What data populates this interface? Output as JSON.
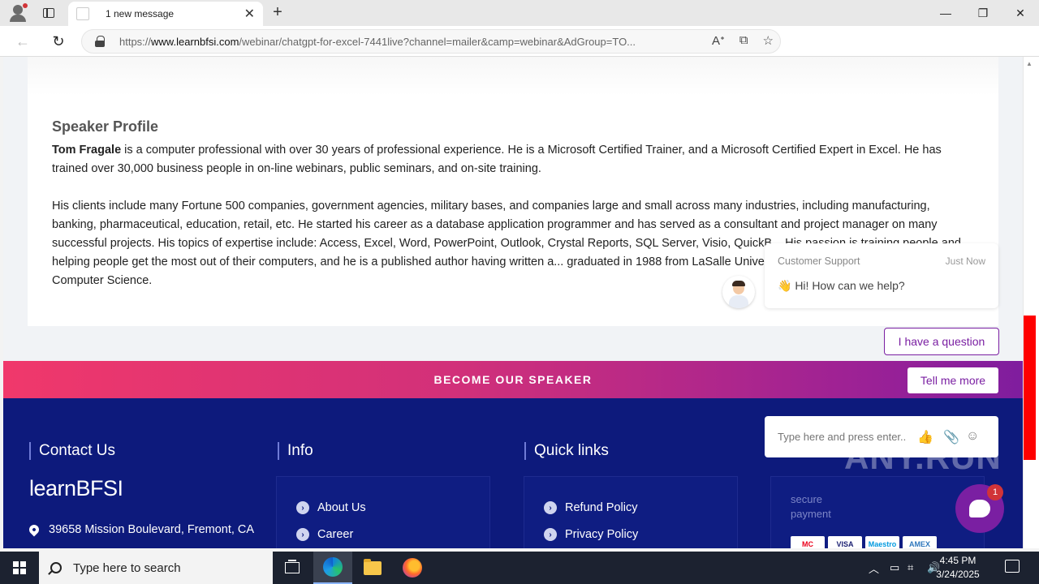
{
  "browser": {
    "tab_title": "1 new message",
    "url_prefix": "https://",
    "url_host": "www.learnbfsi.com",
    "url_rest": "/webinar/chatgpt-for-excel-7441live?channel=mailer&camp=webinar&AdGroup=TO..."
  },
  "speaker": {
    "heading": "Speaker Profile",
    "name": "Tom Fragale",
    "para1_rest": " is a computer professional with over 30 years of professional experience. He is a Microsoft Certified Trainer, and a Microsoft Certified Expert in Excel. He has trained over 30,000 business people in on-line webinars, public seminars, and on-site training.",
    "para2": "His clients include many Fortune 500 companies, government agencies, military bases, and companies large and small across many industries, including manufacturing, banking, pharmaceutical, education, retail, etc. He started his career as a database application programmer and has served as a consultant and project manager on many successful projects. His topics of expertise include: Access, Excel, Word, PowerPoint, Outlook, Crystal Reports, SQL Server, Visio, QuickB... His passion is training people and helping people get the most out of their computers, and he is a published author having written a... graduated in 1988 from LaSalle University in Philadelphia, PA with a BA in Computer Science."
  },
  "banner": {
    "text": "BECOME OUR SPEAKER",
    "button": "Tell me more"
  },
  "footer": {
    "contact_heading": "Contact Us",
    "info_heading": "Info",
    "quick_heading": "Quick links",
    "logo_bold": "learn",
    "logo_rest": "BFSI",
    "address": "39658 Mission Boulevard, Fremont, CA",
    "info_links": [
      "About Us",
      "Career"
    ],
    "quick_links": [
      "Refund Policy",
      "Privacy Policy"
    ],
    "secure_line1": "secure",
    "secure_line2": "payment",
    "cards": [
      "MC",
      "VISA",
      "Maestro",
      "AMEX"
    ]
  },
  "chat": {
    "sender": "Customer Support",
    "time": "Just Now",
    "message": "👋 Hi! How can we help?",
    "question_button": "I have a question",
    "input_placeholder": "Type here and press enter..",
    "badge_count": "1"
  },
  "watermark": "ANY.RUN",
  "taskbar": {
    "search_placeholder": "Type here to search",
    "time": "4:45 PM",
    "date": "3/24/2025"
  }
}
